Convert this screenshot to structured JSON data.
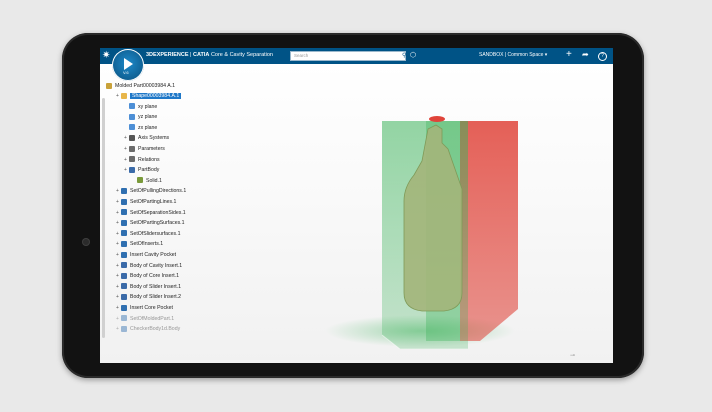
{
  "header": {
    "brand_bold": "3DEXPERIENCE",
    "brand_app": "CATIA",
    "brand_role": "Core & Cavity Separation",
    "search_placeholder": "Search",
    "space_label": "SANDBOX | Common Space",
    "compass_version": "V.6"
  },
  "tree": {
    "root": "Molded Part00003984 A.1",
    "items": [
      {
        "label": "Shape00003984.A.1",
        "selected": true,
        "indent": 1,
        "icon": "shape-icon"
      },
      {
        "label": "xy plane",
        "indent": 2,
        "icon": "plane-icon"
      },
      {
        "label": "yz plane",
        "indent": 2,
        "icon": "plane-icon"
      },
      {
        "label": "zx plane",
        "indent": 2,
        "icon": "plane-icon"
      },
      {
        "label": "Axis Systems",
        "indent": 2,
        "icon": "axis-icon"
      },
      {
        "label": "Parameters",
        "indent": 2,
        "icon": "parameters-icon"
      },
      {
        "label": "Relations",
        "indent": 2,
        "icon": "relations-icon"
      },
      {
        "label": "PartBody",
        "indent": 2,
        "icon": "body-icon"
      },
      {
        "label": "Solid.1",
        "indent": 3,
        "icon": "solid-icon"
      },
      {
        "label": "SetOfPullingDirections.1",
        "indent": 1,
        "icon": "set-icon"
      },
      {
        "label": "SetOfPartingLines.1",
        "indent": 1,
        "icon": "set-icon"
      },
      {
        "label": "SetOfSeparationSides.1",
        "indent": 1,
        "icon": "set-icon"
      },
      {
        "label": "SetOfPartingSurfaces.1",
        "indent": 1,
        "icon": "set-icon"
      },
      {
        "label": "SetOfSlidersurfaces.1",
        "indent": 1,
        "icon": "set-icon"
      },
      {
        "label": "SetOfInserts.1",
        "indent": 1,
        "icon": "set-icon"
      },
      {
        "label": "Insert Cavity Pocket",
        "indent": 1,
        "icon": "pocket-icon"
      },
      {
        "label": "Body of Cavity Insert.1",
        "indent": 1,
        "icon": "body-icon"
      },
      {
        "label": "Body of Core Insert.1",
        "indent": 1,
        "icon": "body-icon"
      },
      {
        "label": "Body of Slider Insert.1",
        "indent": 1,
        "icon": "body-icon"
      },
      {
        "label": "Body of Slider Insert.2",
        "indent": 1,
        "icon": "body-icon"
      },
      {
        "label": "Insert Core Pocket",
        "indent": 1,
        "icon": "pocket-icon"
      },
      {
        "label": "SetOfMoldedPart.1",
        "indent": 1,
        "icon": "set-icon",
        "faded": true
      },
      {
        "label": "CheckerBody1d.Body",
        "indent": 1,
        "icon": "set-icon",
        "faded": true
      }
    ]
  },
  "colors": {
    "topbar": "#005386",
    "core": "#3cb35a",
    "cavity": "#e0443a",
    "selection": "#1f78c8"
  }
}
